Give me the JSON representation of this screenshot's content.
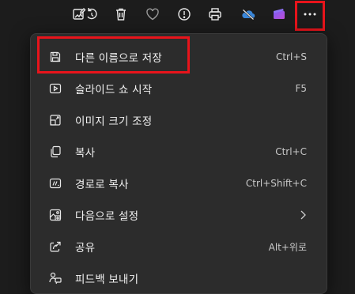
{
  "toolbar": {
    "icons": [
      "edit-image-icon",
      "rotate-icon",
      "delete-icon",
      "favorite-heart-icon",
      "info-icon",
      "print-icon",
      "onedrive-sync-off-icon",
      "clipchamp-icon",
      "more-options-icon"
    ]
  },
  "menu": {
    "items": [
      {
        "label": "다른 이름으로 저장",
        "shortcut": "Ctrl+S",
        "icon": "save-icon"
      },
      {
        "label": "슬라이드 쇼 시작",
        "shortcut": "F5",
        "icon": "slideshow-icon"
      },
      {
        "label": "이미지 크기 조정",
        "shortcut": "",
        "icon": "resize-image-icon"
      },
      {
        "label": "복사",
        "shortcut": "Ctrl+C",
        "icon": "copy-icon"
      },
      {
        "label": "경로로 복사",
        "shortcut": "Ctrl+Shift+C",
        "icon": "copy-path-icon"
      },
      {
        "label": "다음으로 설정",
        "shortcut": "",
        "icon": "set-as-icon",
        "has_submenu": true
      },
      {
        "label": "공유",
        "shortcut": "Alt+위로",
        "icon": "share-icon"
      },
      {
        "label": "피드백 보내기",
        "shortcut": "",
        "icon": "feedback-icon"
      }
    ]
  },
  "colors": {
    "highlight": "#e8141b",
    "menu_bg": "#2c2c2c",
    "page_bg": "#1c1c1c"
  }
}
